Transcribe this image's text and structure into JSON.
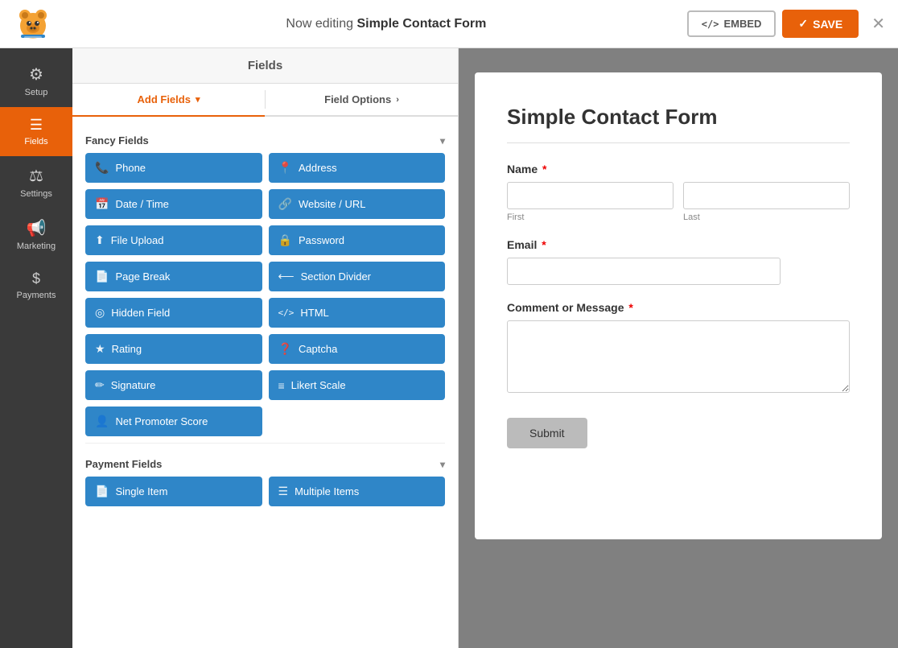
{
  "header": {
    "editing_label": "Now editing",
    "form_name": "Simple Contact Form",
    "embed_label": "EMBED",
    "save_label": "SAVE",
    "embed_icon": "</>",
    "save_icon": "✓"
  },
  "sidebar": {
    "items": [
      {
        "id": "setup",
        "label": "Setup",
        "icon": "⚙"
      },
      {
        "id": "fields",
        "label": "Fields",
        "icon": "☰",
        "active": true
      },
      {
        "id": "settings",
        "label": "Settings",
        "icon": "⚖"
      },
      {
        "id": "marketing",
        "label": "Marketing",
        "icon": "📢"
      },
      {
        "id": "payments",
        "label": "Payments",
        "icon": "$"
      }
    ]
  },
  "fields_panel": {
    "header_label": "Fields",
    "tabs": [
      {
        "id": "add-fields",
        "label": "Add Fields",
        "active": true,
        "chevron": "▾"
      },
      {
        "id": "field-options",
        "label": "Field Options",
        "active": false,
        "chevron": "›"
      }
    ],
    "sections": [
      {
        "id": "fancy-fields",
        "label": "Fancy Fields",
        "collapsed": false,
        "buttons": [
          {
            "id": "phone",
            "label": "Phone",
            "icon": "📞"
          },
          {
            "id": "address",
            "label": "Address",
            "icon": "📍"
          },
          {
            "id": "date-time",
            "label": "Date / Time",
            "icon": "📅"
          },
          {
            "id": "website-url",
            "label": "Website / URL",
            "icon": "🔗"
          },
          {
            "id": "file-upload",
            "label": "File Upload",
            "icon": "⬆"
          },
          {
            "id": "password",
            "label": "Password",
            "icon": "🔒"
          },
          {
            "id": "page-break",
            "label": "Page Break",
            "icon": "📄"
          },
          {
            "id": "section-divider",
            "label": "Section Divider",
            "icon": "⟵"
          },
          {
            "id": "hidden-field",
            "label": "Hidden Field",
            "icon": "◎"
          },
          {
            "id": "html",
            "label": "HTML",
            "icon": "</>"
          },
          {
            "id": "rating",
            "label": "Rating",
            "icon": "★"
          },
          {
            "id": "captcha",
            "label": "Captcha",
            "icon": "❓"
          },
          {
            "id": "signature",
            "label": "Signature",
            "icon": "✏"
          },
          {
            "id": "likert-scale",
            "label": "Likert Scale",
            "icon": "≡"
          },
          {
            "id": "net-promoter-score",
            "label": "Net Promoter Score",
            "icon": "👤",
            "full": true
          }
        ]
      },
      {
        "id": "payment-fields",
        "label": "Payment Fields",
        "collapsed": false,
        "buttons": [
          {
            "id": "single-item",
            "label": "Single Item",
            "icon": "📄"
          },
          {
            "id": "multiple-items",
            "label": "Multiple Items",
            "icon": "☰"
          }
        ]
      }
    ]
  },
  "form_preview": {
    "title": "Simple Contact Form",
    "fields": [
      {
        "id": "name",
        "label": "Name",
        "required": true,
        "type": "name",
        "sub_fields": [
          {
            "placeholder": "",
            "sub_label": "First"
          },
          {
            "placeholder": "",
            "sub_label": "Last"
          }
        ]
      },
      {
        "id": "email",
        "label": "Email",
        "required": true,
        "type": "text",
        "placeholder": ""
      },
      {
        "id": "comment",
        "label": "Comment or Message",
        "required": true,
        "type": "textarea",
        "placeholder": ""
      }
    ],
    "submit_label": "Submit"
  }
}
